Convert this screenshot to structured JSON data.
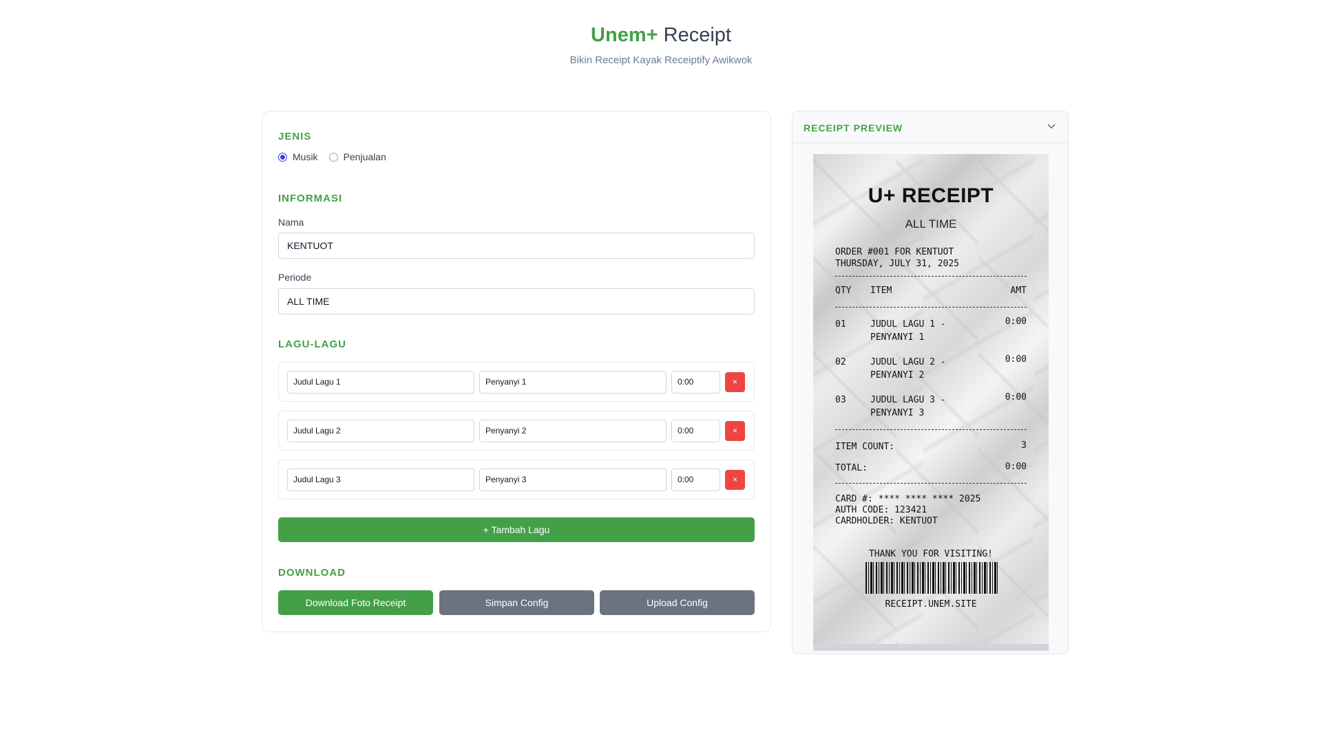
{
  "header": {
    "brand": "Unem+",
    "title_rest": "Receipt",
    "subtitle": "Bikin Receipt Kayak Receiptify Awikwok"
  },
  "form": {
    "jenis": {
      "heading": "JENIS",
      "options": [
        {
          "label": "Musik",
          "checked": true
        },
        {
          "label": "Penjualan",
          "checked": false
        }
      ]
    },
    "informasi": {
      "heading": "INFORMASI",
      "nama_label": "Nama",
      "nama_value": "KENTUOT",
      "periode_label": "Periode",
      "periode_value": "ALL TIME"
    },
    "lagu": {
      "heading": "LAGU-LAGU",
      "songs": [
        {
          "title": "Judul Lagu 1",
          "artist": "Penyanyi 1",
          "duration": "0:00",
          "delete": "×"
        },
        {
          "title": "Judul Lagu 2",
          "artist": "Penyanyi 2",
          "duration": "0:00",
          "delete": "×"
        },
        {
          "title": "Judul Lagu 3",
          "artist": "Penyanyi 3",
          "duration": "0:00",
          "delete": "×"
        }
      ],
      "add_button": "+ Tambah Lagu"
    },
    "download": {
      "heading": "DOWNLOAD",
      "download_button": "Download Foto Receipt",
      "save_button": "Simpan Config",
      "upload_button": "Upload Config"
    }
  },
  "preview": {
    "heading": "RECEIPT PREVIEW",
    "receipt": {
      "title": "U+ RECEIPT",
      "period": "ALL TIME",
      "order_line": "ORDER #001 FOR KENTUOT",
      "date_line": "THURSDAY, JULY 31, 2025",
      "col_qty": "QTY",
      "col_item": "ITEM",
      "col_amt": "AMT",
      "items": [
        {
          "qty": "01",
          "line1": "JUDUL LAGU 1 -",
          "line2": "PENYANYI 1",
          "amt": "0:00"
        },
        {
          "qty": "02",
          "line1": "JUDUL LAGU 2 -",
          "line2": "PENYANYI 2",
          "amt": "0:00"
        },
        {
          "qty": "03",
          "line1": "JUDUL LAGU 3 -",
          "line2": "PENYANYI 3",
          "amt": "0:00"
        }
      ],
      "item_count_label": "ITEM COUNT:",
      "item_count_value": "3",
      "total_label": "TOTAL:",
      "total_value": "0:00",
      "card_line": "CARD #: **** **** **** 2025",
      "auth_line": "AUTH CODE: 123421",
      "holder_line": "CARDHOLDER: KENTUOT",
      "thanks": "THANK YOU FOR VISITING!",
      "site": "RECEIPT.UNEM.SITE"
    }
  },
  "colors": {
    "accent": "#43a047",
    "danger": "#ef4444",
    "secondary_button": "#6b7280",
    "radio": "#3b3bd6"
  }
}
